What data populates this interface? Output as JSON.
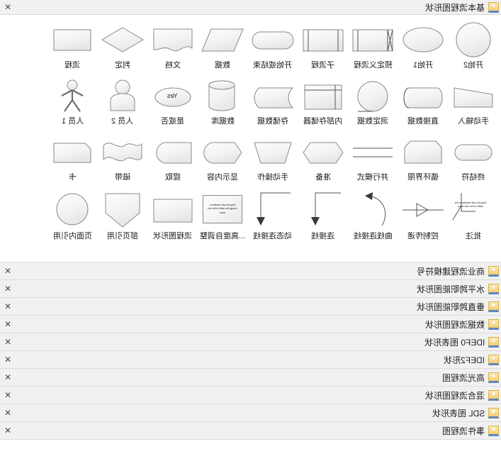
{
  "header": {
    "title": "基本流程图形状",
    "close_label": "✕",
    "star_icon": "star-icon"
  },
  "gallery": {
    "rows": [
      {
        "shapes": [
          {
            "label": "开始2",
            "icon": "circle-shape"
          },
          {
            "label": "开始1",
            "icon": "ellipse-shape"
          },
          {
            "label": "预定义流程",
            "icon": "predefined-process-shape"
          },
          {
            "label": "子流程",
            "icon": "subprocess-shape"
          },
          {
            "label": "开始或结束",
            "icon": "terminator-shape"
          },
          {
            "label": "数据",
            "icon": "data-parallelogram-shape"
          },
          {
            "label": "文档",
            "icon": "document-shape"
          },
          {
            "label": "判定",
            "icon": "decision-diamond-shape"
          },
          {
            "label": "流程",
            "icon": "process-rectangle-shape"
          }
        ]
      },
      {
        "shapes": [
          {
            "label": "手动输入",
            "icon": "manual-input-shape"
          },
          {
            "label": "直接数据",
            "icon": "direct-data-shape"
          },
          {
            "label": "测定数据",
            "icon": "sequential-data-shape"
          },
          {
            "label": "内部存储器",
            "icon": "internal-storage-shape"
          },
          {
            "label": "存储数据",
            "icon": "stored-data-shape"
          },
          {
            "label": "数据库",
            "icon": "database-cylinder-shape"
          },
          {
            "label": "是或否",
            "icon": "yes-no-ellipse-shape",
            "text": "Yes"
          },
          {
            "label": "人员 2",
            "icon": "person-bust-shape"
          },
          {
            "label": "人员 1",
            "icon": "person-stick-shape"
          }
        ]
      },
      {
        "shapes": [
          {
            "label": "终结符",
            "icon": "terminator-rounded-shape"
          },
          {
            "label": "循环界限",
            "icon": "loop-limit-shape"
          },
          {
            "label": "并行模式",
            "icon": "parallel-mode-shape"
          },
          {
            "label": "准备",
            "icon": "preparation-hexagon-shape"
          },
          {
            "label": "手动操作",
            "icon": "manual-operation-shape"
          },
          {
            "label": "显示内容",
            "icon": "display-shape"
          },
          {
            "label": "提取",
            "icon": "extract-shape"
          },
          {
            "label": "磁带",
            "icon": "magnetic-tape-shape"
          },
          {
            "label": "卡",
            "icon": "card-shape"
          }
        ]
      },
      {
        "shapes": [
          {
            "label": "批注",
            "icon": "annotation-shape",
            "text": "Drag the side handles to the width of the note block"
          },
          {
            "label": "控制传递",
            "icon": "control-transfer-shape"
          },
          {
            "label": "曲线连接线",
            "icon": "curved-connector-shape"
          },
          {
            "label": "连接线",
            "icon": "connector-shape"
          },
          {
            "label": "动态连接线",
            "icon": "dynamic-connector-shape"
          },
          {
            "label": "高度自调整...",
            "icon": "auto-height-box-shape",
            "text": "Drag the side handles to change the width of the text block"
          },
          {
            "label": "流程图形状",
            "icon": "flowchart-shape-box"
          },
          {
            "label": "部页引用",
            "icon": "off-page-reference-shape"
          },
          {
            "label": "页面内引用",
            "icon": "on-page-reference-shape"
          }
        ]
      }
    ]
  },
  "stencil_list": {
    "close_label": "✕",
    "items": [
      {
        "title": "商业流程建模符号"
      },
      {
        "title": "水平跨职能图形状"
      },
      {
        "title": "垂直跨职能图形状"
      },
      {
        "title": "数据流程图形状"
      },
      {
        "title": "IDEF0 图表形状"
      },
      {
        "title": "IDEF2形状"
      },
      {
        "title": "高光流程图"
      },
      {
        "title": "混合流程图形状"
      },
      {
        "title": "SDL 图表形状"
      },
      {
        "title": "事件流程图"
      }
    ]
  },
  "colors": {
    "header_bg": "#f1f1f1",
    "shape_stroke": "#8a8a8a",
    "star_gold": "#f5cf72",
    "star_blue": "#5b86c4"
  }
}
